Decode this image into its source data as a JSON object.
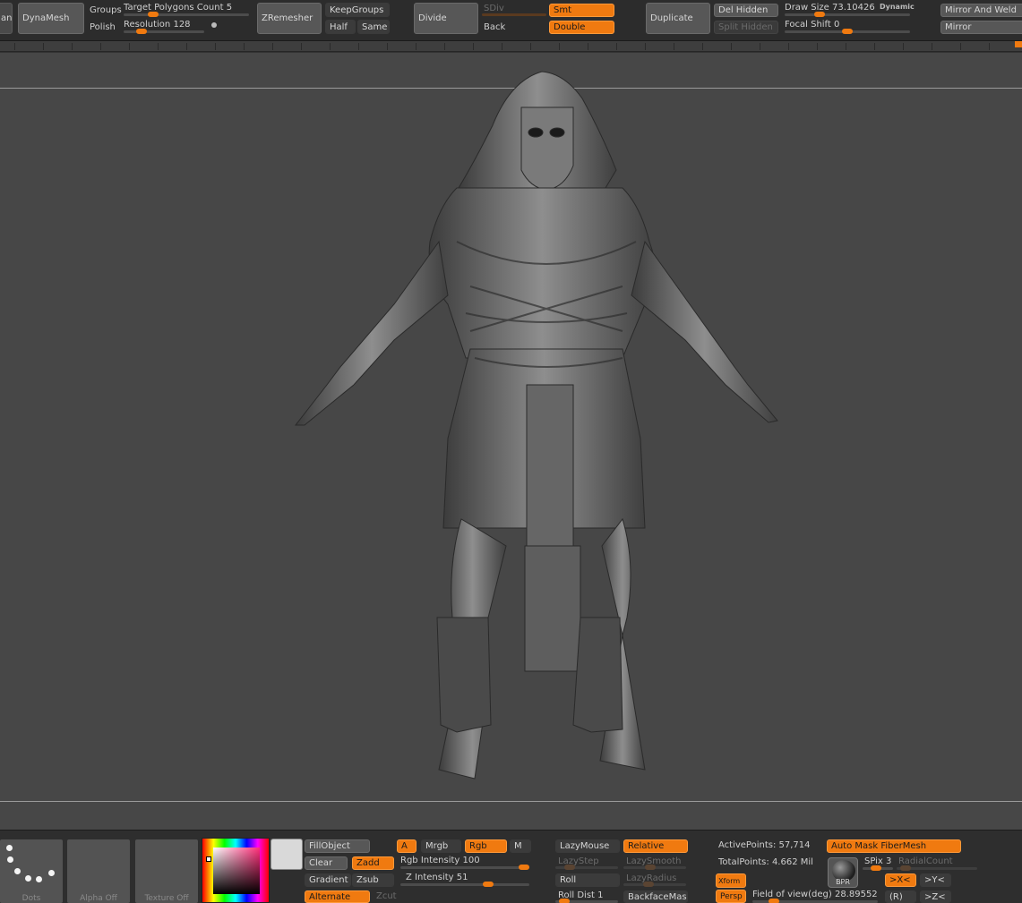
{
  "top": {
    "cut_left": "an",
    "dynamesh": "DynaMesh",
    "groups": "Groups",
    "polish": "Polish",
    "target_polygons": "Target Polygons Count",
    "target_polygons_value": "5",
    "resolution": "Resolution",
    "resolution_value": "128",
    "zremesher": "ZRemesher",
    "keepgroups": "KeepGroups",
    "half": "Half",
    "same": "Same",
    "divide": "Divide",
    "sdiv": "SDiv",
    "back": "Back",
    "smt": "Smt",
    "double": "Double",
    "duplicate": "Duplicate",
    "del_hidden": "Del Hidden",
    "split_hidden": "Split Hidden",
    "draw_size": "Draw Size",
    "draw_size_value": "73.10426",
    "dynamic": "Dynamic",
    "focal_shift": "Focal Shift",
    "focal_shift_value": "0",
    "mirror_weld": "Mirror And Weld",
    "mirror": "Mirror"
  },
  "bottom": {
    "dots": "Dots",
    "alpha_off": "Alpha Off",
    "texture_off": "Texture Off",
    "fillobject": "FillObject",
    "clear": "Clear",
    "zadd": "Zadd",
    "gradient": "Gradient",
    "zsub": "Zsub",
    "alternate": "Alternate",
    "zcut": "Zcut",
    "a": "A",
    "mrgb": "Mrgb",
    "rgb": "Rgb",
    "m": "M",
    "rgb_intensity": "Rgb Intensity",
    "rgb_intensity_value": "100",
    "z_intensity": "Z Intensity",
    "z_intensity_value": "51",
    "lazymouse": "LazyMouse",
    "relative": "Relative",
    "lazystep": "LazyStep",
    "lazysmooth": "LazySmooth",
    "roll": "Roll",
    "lazyradius": "LazyRadius",
    "roll_dist": "Roll Dist",
    "roll_dist_value": "1",
    "backfacemask": "BackfaceMask",
    "active_points": "ActivePoints: 57,714",
    "total_points": "TotalPoints: 4.662 Mil",
    "auto_mask": "Auto Mask FiberMesh",
    "bpr": "BPR",
    "spix": "SPix",
    "spix_value": "3",
    "radial_count": "RadialCount",
    "xform": "Xform",
    "persp": "Persp",
    "fov": "Field of view(deg)",
    "fov_value": "28.89552",
    "x_axis": ">X<",
    "y_axis": ">Y<",
    "r": "(R)",
    "z_axis": ">Z<"
  },
  "colors": {
    "accent": "#f07a10",
    "panel": "#2c2c2c",
    "canvas": "#474747"
  },
  "icons": {
    "model": "pharaoh-sculpt"
  }
}
